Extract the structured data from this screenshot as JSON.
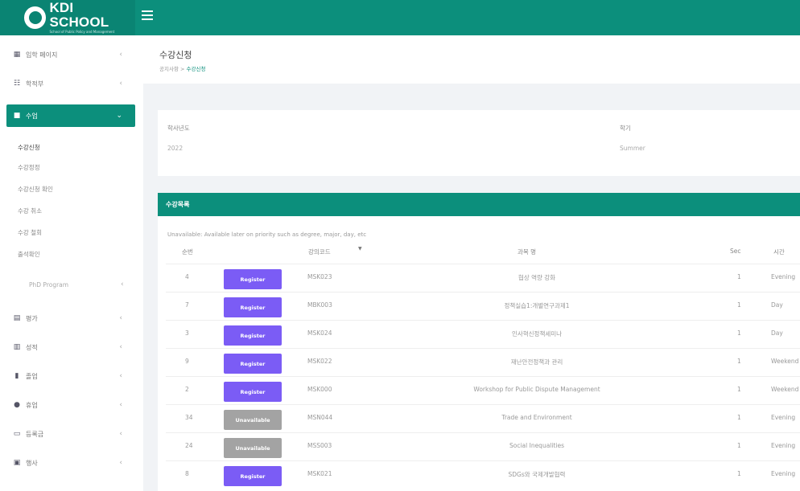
{
  "brand": {
    "name": "KDI SCHOOL",
    "subtitle": "School of Public Policy and Management"
  },
  "sidebar": {
    "items": [
      {
        "label": "입학 페이지",
        "icon": "grid-icon"
      },
      {
        "label": "학적부",
        "icon": "list-icon"
      },
      {
        "label": "수업",
        "icon": "book-icon"
      },
      {
        "label": "평가",
        "icon": "clipboard-icon"
      },
      {
        "label": "성적",
        "icon": "bar-chart-icon"
      },
      {
        "label": "졸업",
        "icon": "chart-icon"
      },
      {
        "label": "휴업",
        "icon": "users-icon"
      },
      {
        "label": "등록금",
        "icon": "money-icon"
      },
      {
        "label": "행사",
        "icon": "calendar-icon"
      }
    ],
    "sub_items": [
      "수강신청",
      "수강정정",
      "수강신청 확인",
      "수강 취소",
      "수강 철회",
      "출석확인"
    ],
    "phd": "PhD Program"
  },
  "page": {
    "title": "수강신청",
    "breadcrumb_home": "공지사항",
    "breadcrumb_sep": ">",
    "breadcrumb_current": "수강신청"
  },
  "term": {
    "year_label": "학사년도",
    "year_value": "2022",
    "term_label": "학기",
    "term_value": "Summer"
  },
  "course_list": {
    "title": "수강목록",
    "notice": "Unavailable: Available later on priority such as degree, major, day, etc",
    "columns": [
      "순번",
      "강의코드",
      "과목 명",
      "Sec",
      "시간"
    ],
    "rows": [
      {
        "no": "4",
        "action": "Register",
        "code": "MSK023",
        "name": "협상 역량 강화",
        "sec": "1",
        "time": "Evening"
      },
      {
        "no": "7",
        "action": "Register",
        "code": "MBK003",
        "name": "정책실습1:개별연구과제1",
        "sec": "1",
        "time": "Day"
      },
      {
        "no": "3",
        "action": "Register",
        "code": "MSK024",
        "name": "인사혁신정책세미나",
        "sec": "1",
        "time": "Day"
      },
      {
        "no": "9",
        "action": "Register",
        "code": "MSK022",
        "name": "재난안전정책과 관리",
        "sec": "1",
        "time": "Weekend"
      },
      {
        "no": "2",
        "action": "Register",
        "code": "MSK000",
        "name": "Workshop for Public Dispute Management",
        "sec": "1",
        "time": "Weekend"
      },
      {
        "no": "34",
        "action": "Unavailable",
        "code": "MSN044",
        "name": "Trade and Environment",
        "sec": "1",
        "time": "Evening"
      },
      {
        "no": "24",
        "action": "Unavailable",
        "code": "MSS003",
        "name": "Social Inequalities",
        "sec": "1",
        "time": "Evening"
      },
      {
        "no": "8",
        "action": "Register",
        "code": "MSK021",
        "name": "SDGs와 국제개발협력",
        "sec": "1",
        "time": "Evening"
      }
    ]
  },
  "colors": {
    "primary": "#0c8f7c",
    "register": "#7b5cf5",
    "unavailable": "#a3a3a3"
  }
}
